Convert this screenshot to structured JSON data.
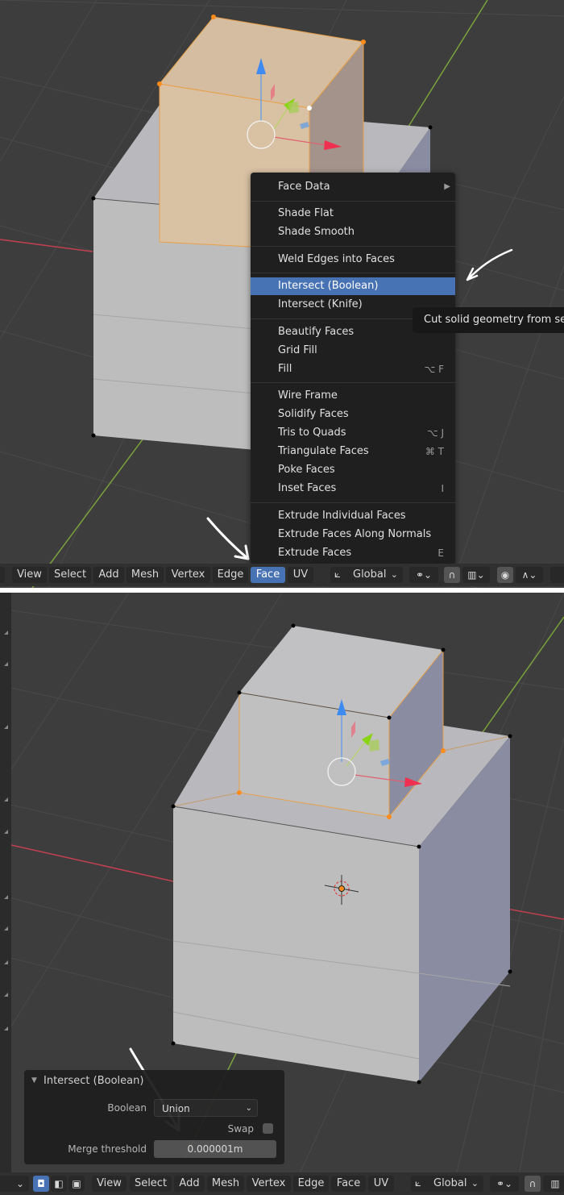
{
  "colors": {
    "accent": "#4772b3",
    "viewport_bg": "#3d3d3d",
    "menu_bg": "#1f1f1f",
    "selected_face": "#e8c9a1",
    "vertex_selected": "#ff8c1a",
    "axis_x": "#c2404f",
    "axis_y": "#7aa33b"
  },
  "top": {
    "context_menu": {
      "items": [
        {
          "label": "Face Data",
          "shortcut": "",
          "submenu": true
        },
        {
          "label": "Shade Flat",
          "shortcut": ""
        },
        {
          "label": "Shade Smooth",
          "shortcut": ""
        },
        {
          "label": "Weld Edges into Faces",
          "shortcut": ""
        },
        {
          "label": "Intersect (Boolean)",
          "shortcut": "",
          "active": true
        },
        {
          "label": "Intersect (Knife)",
          "shortcut": ""
        },
        {
          "label": "Beautify Faces",
          "shortcut": ""
        },
        {
          "label": "Grid Fill",
          "shortcut": ""
        },
        {
          "label": "Fill",
          "shortcut": "⌥ F"
        },
        {
          "label": "Wire Frame",
          "shortcut": ""
        },
        {
          "label": "Solidify Faces",
          "shortcut": ""
        },
        {
          "label": "Tris to Quads",
          "shortcut": "⌥ J"
        },
        {
          "label": "Triangulate Faces",
          "shortcut": "⌘ T"
        },
        {
          "label": "Poke Faces",
          "shortcut": ""
        },
        {
          "label": "Inset Faces",
          "shortcut": "I"
        },
        {
          "label": "Extrude Individual Faces",
          "shortcut": ""
        },
        {
          "label": "Extrude Faces Along Normals",
          "shortcut": ""
        },
        {
          "label": "Extrude Faces",
          "shortcut": "E"
        }
      ],
      "submenu_arrow": "▶"
    },
    "tooltip": "Cut solid geometry from selected",
    "header": {
      "menus": [
        "View",
        "Select",
        "Add",
        "Mesh",
        "Vertex",
        "Edge",
        "Face",
        "UV"
      ],
      "active_menu": "Face",
      "orientation": "Global",
      "chevron": "⌄"
    }
  },
  "bottom": {
    "operator_panel": {
      "title": "Intersect (Boolean)",
      "collapse_icon": "▼",
      "boolean_label": "Boolean",
      "boolean_value": "Union",
      "swap_label": "Swap",
      "swap_checked": false,
      "merge_label": "Merge threshold",
      "merge_value": "0.000001m"
    },
    "header": {
      "menus": [
        "View",
        "Select",
        "Add",
        "Mesh",
        "Vertex",
        "Edge",
        "Face",
        "UV"
      ],
      "orientation": "Global",
      "select_modes": [
        "vertex-select",
        "edge-select",
        "face-select"
      ],
      "active_select_mode": "vertex-select"
    }
  }
}
